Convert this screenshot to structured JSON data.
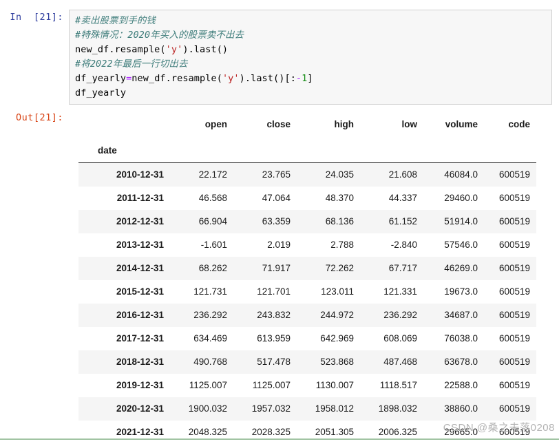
{
  "notebook": {
    "input_prompt": "In  [21]:",
    "output_prompt": "Out[21]:",
    "code_lines": [
      {
        "tokens": [
          {
            "text": "#卖出股票到手的钱",
            "type": "comment"
          }
        ]
      },
      {
        "tokens": [
          {
            "text": "#特殊情况：2020年买入的股票卖不出去",
            "type": "comment"
          }
        ]
      },
      {
        "tokens": [
          {
            "text": "new_df.resample(",
            "type": "name"
          },
          {
            "text": "'y'",
            "type": "str"
          },
          {
            "text": ").last()",
            "type": "name"
          }
        ]
      },
      {
        "tokens": [
          {
            "text": "#将2022年最后一行切出去",
            "type": "comment"
          }
        ]
      },
      {
        "tokens": [
          {
            "text": "df_yearly",
            "type": "name"
          },
          {
            "text": "=",
            "type": "op"
          },
          {
            "text": "new_df.resample(",
            "type": "name"
          },
          {
            "text": "'y'",
            "type": "str"
          },
          {
            "text": ").last()[:",
            "type": "name"
          },
          {
            "text": "-",
            "type": "op"
          },
          {
            "text": "1",
            "type": "num"
          },
          {
            "text": "]",
            "type": "name"
          }
        ]
      },
      {
        "tokens": [
          {
            "text": "df_yearly",
            "type": "name"
          }
        ]
      }
    ]
  },
  "dataframe": {
    "index_name": "date",
    "columns": [
      "open",
      "close",
      "high",
      "low",
      "volume",
      "code"
    ],
    "rows": [
      {
        "date": "2010-12-31",
        "values": [
          "22.172",
          "23.765",
          "24.035",
          "21.608",
          "46084.0",
          "600519"
        ]
      },
      {
        "date": "2011-12-31",
        "values": [
          "46.568",
          "47.064",
          "48.370",
          "44.337",
          "29460.0",
          "600519"
        ]
      },
      {
        "date": "2012-12-31",
        "values": [
          "66.904",
          "63.359",
          "68.136",
          "61.152",
          "51914.0",
          "600519"
        ]
      },
      {
        "date": "2013-12-31",
        "values": [
          "-1.601",
          "2.019",
          "2.788",
          "-2.840",
          "57546.0",
          "600519"
        ]
      },
      {
        "date": "2014-12-31",
        "values": [
          "68.262",
          "71.917",
          "72.262",
          "67.717",
          "46269.0",
          "600519"
        ]
      },
      {
        "date": "2015-12-31",
        "values": [
          "121.731",
          "121.701",
          "123.011",
          "121.331",
          "19673.0",
          "600519"
        ]
      },
      {
        "date": "2016-12-31",
        "values": [
          "236.292",
          "243.832",
          "244.972",
          "236.292",
          "34687.0",
          "600519"
        ]
      },
      {
        "date": "2017-12-31",
        "values": [
          "634.469",
          "613.959",
          "642.969",
          "608.069",
          "76038.0",
          "600519"
        ]
      },
      {
        "date": "2018-12-31",
        "values": [
          "490.768",
          "517.478",
          "523.868",
          "487.468",
          "63678.0",
          "600519"
        ]
      },
      {
        "date": "2019-12-31",
        "values": [
          "1125.007",
          "1125.007",
          "1130.007",
          "1118.517",
          "22588.0",
          "600519"
        ]
      },
      {
        "date": "2020-12-31",
        "values": [
          "1900.032",
          "1957.032",
          "1958.012",
          "1898.032",
          "38860.0",
          "600519"
        ]
      },
      {
        "date": "2021-12-31",
        "values": [
          "2048.325",
          "2028.325",
          "2051.305",
          "2006.325",
          "29665.0",
          "600519"
        ]
      }
    ]
  },
  "watermark": {
    "text": "CSDN @桑之未落0208"
  },
  "colors": {
    "prompt_in": "#303f9f",
    "prompt_out": "#d84315",
    "comment": "#3f7d7b",
    "string": "#ba2121",
    "operator": "#aa22ff",
    "number": "#1a8f1a",
    "code_bg": "#f7f7f7",
    "code_border": "#cfcfcf",
    "row_stripe": "#f5f5f5",
    "watermark": "#b3b3b3"
  }
}
